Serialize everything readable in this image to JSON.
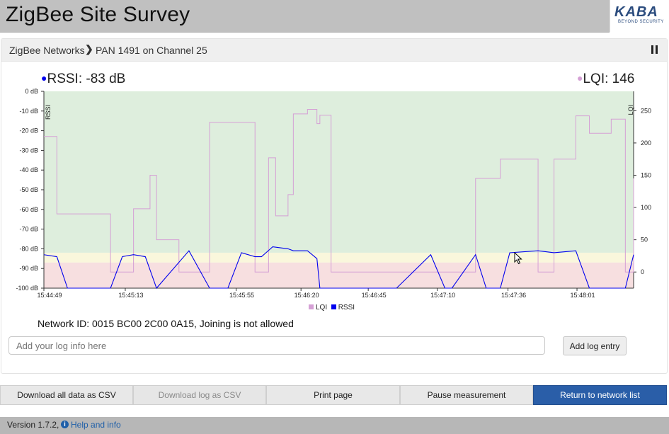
{
  "header": {
    "title": "ZigBee Site Survey",
    "logo_text": "KABA",
    "logo_tagline": "BEYOND SECURITY"
  },
  "breadcrumb": {
    "root": "ZigBee Networks",
    "current": "PAN 1491 on Channel 25"
  },
  "readouts": {
    "rssi": "RSSI: -83 dB",
    "lqi": "LQI: 146"
  },
  "colors": {
    "rssi": "#0000ee",
    "lqi": "#d5a0d5",
    "zone_good": "#deeedd",
    "zone_warn": "#faf7dc",
    "zone_bad": "#f7dfe0",
    "primary_button": "#2a5ea8"
  },
  "chart_data": {
    "type": "line",
    "left_axis_label": "RSSI",
    "right_axis_label": "LQI",
    "left_ylim": [
      -100,
      0
    ],
    "right_ylim": [
      -25,
      280
    ],
    "left_ticks": [
      "0 dB",
      "-10 dB",
      "-20 dB",
      "-30 dB",
      "-40 dB",
      "-50 dB",
      "-60 dB",
      "-70 dB",
      "-80 dB",
      "-90 dB",
      "-100 dB"
    ],
    "left_tick_values": [
      0,
      -10,
      -20,
      -30,
      -40,
      -50,
      -60,
      -70,
      -80,
      -90,
      -100
    ],
    "right_ticks": [
      "250",
      "200",
      "150",
      "100",
      "50",
      "0"
    ],
    "right_tick_values": [
      250,
      200,
      150,
      100,
      50,
      0
    ],
    "x_ticks": [
      "15:44:49",
      "15:45:13",
      "15:45:55",
      "15:46:20",
      "15:46:45",
      "15:47:10",
      "15:47:36",
      "15:48:01"
    ],
    "x_tick_fracs": [
      0,
      0.138,
      0.326,
      0.436,
      0.55,
      0.667,
      0.787,
      0.904
    ],
    "zones": [
      {
        "name": "good",
        "from": 0,
        "to": -82
      },
      {
        "name": "warn",
        "from": -82,
        "to": -87
      },
      {
        "name": "bad",
        "from": -87,
        "to": -100
      }
    ],
    "series": [
      {
        "name": "LQI",
        "x": [
          0,
          0.012,
          0.022,
          0.042,
          0.113,
          0.133,
          0.152,
          0.18,
          0.191,
          0.229,
          0.246,
          0.281,
          0.335,
          0.358,
          0.369,
          0.381,
          0.393,
          0.414,
          0.423,
          0.447,
          0.463,
          0.468,
          0.487,
          0.498,
          0.513,
          0.56,
          0.598,
          0.656,
          0.692,
          0.732,
          0.774,
          0.838,
          0.865,
          0.902,
          0.925,
          0.962,
          0.986,
          1
        ],
        "y": [
          210,
          210,
          90,
          90,
          0,
          0,
          98,
          150,
          50,
          0,
          0,
          232,
          232,
          0,
          0,
          177,
          87,
          120,
          245,
          252,
          230,
          243,
          0,
          0,
          0,
          0,
          0,
          0,
          0,
          145,
          175,
          0,
          175,
          242,
          215,
          237,
          0,
          145
        ]
      },
      {
        "name": "RSSI",
        "x": [
          0,
          0.022,
          0.04,
          0.062,
          0.113,
          0.133,
          0.152,
          0.172,
          0.191,
          0.246,
          0.281,
          0.312,
          0.335,
          0.358,
          0.369,
          0.388,
          0.414,
          0.423,
          0.447,
          0.463,
          0.468,
          0.487,
          0.498,
          0.513,
          0.56,
          0.598,
          0.656,
          0.68,
          0.692,
          0.732,
          0.75,
          0.774,
          0.79,
          0.838,
          0.865,
          0.902,
          0.925,
          0.946,
          0.962,
          0.986,
          1
        ],
        "y": [
          -83,
          -84,
          -100,
          -100,
          -100,
          -84,
          -83,
          -84,
          -100,
          -81,
          -100,
          -100,
          -82,
          -84,
          -84,
          -79,
          -80,
          -81,
          -81,
          -85,
          -100,
          -100,
          -100,
          -100,
          -100,
          -100,
          -83,
          -100,
          -100,
          -83,
          -100,
          -100,
          -82,
          -81,
          -82,
          -81,
          -100,
          -100,
          -100,
          -100,
          -83
        ]
      }
    ]
  },
  "legend": {
    "lqi": "LQI",
    "rssi": "RSSI"
  },
  "network_info": "Network ID: 0015 BC00 2C00 0A15, Joining is not allowed",
  "log": {
    "placeholder": "Add your log info here",
    "add_button": "Add log entry"
  },
  "buttons": {
    "download_all": "Download all data as CSV",
    "download_log": "Download log as CSV",
    "print": "Print page",
    "pause": "Pause measurement",
    "return": "Return to network list"
  },
  "footer": {
    "version": "Version 1.7.2,",
    "help": "Help and info"
  }
}
